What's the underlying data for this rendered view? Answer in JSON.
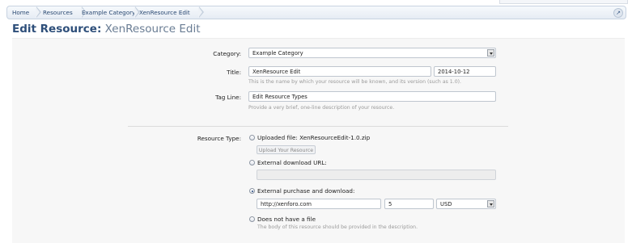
{
  "breadcrumb": {
    "items": [
      "Home",
      "Resources",
      "Example Category",
      "XenResource Edit"
    ],
    "jump_icon": "arrow-up-right-icon"
  },
  "page_title": {
    "prefix": "Edit Resource:",
    "name": "XenResource Edit"
  },
  "form": {
    "category": {
      "label": "Category:",
      "value": "Example Category"
    },
    "title": {
      "label": "Title:",
      "value": "XenResource Edit",
      "version": "2014-10-12",
      "hint": "This is the name by which your resource will be known, and its version (such as 1.0)."
    },
    "tag_line": {
      "label": "Tag Line:",
      "value": "Edit Resource Types",
      "hint": "Provide a very brief, one-line description of your resource."
    },
    "resource_type": {
      "label": "Resource Type:",
      "uploaded": {
        "label": "Uploaded file: XenResourceEdit-1.0.zip",
        "button": "Upload Your Resource"
      },
      "external_url": {
        "label": "External download URL:",
        "value": ""
      },
      "external_purchase": {
        "label": "External purchase and download:",
        "url": "http://xenforo.com",
        "price": "5",
        "currency": "USD"
      },
      "no_file": {
        "label": "Does not have a file",
        "hint": "The body of this resource should be provided in the description."
      }
    }
  }
}
